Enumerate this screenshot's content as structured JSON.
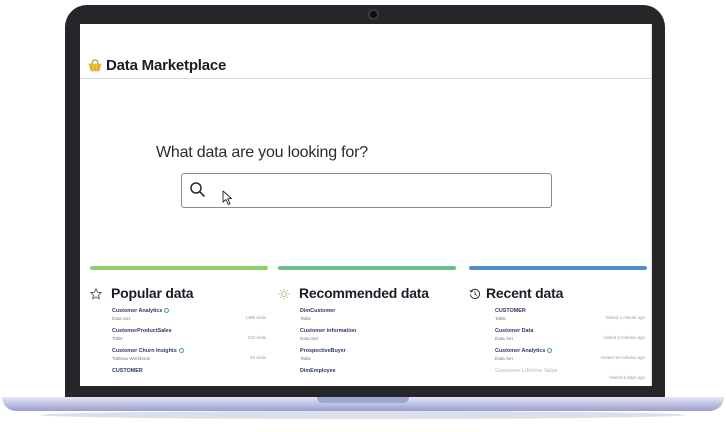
{
  "header": {
    "title": "Data Marketplace"
  },
  "search": {
    "question": "What data are you looking for?",
    "value": ""
  },
  "colors": {
    "popular_bar": "#8fcf6a",
    "recommended_bar": "#6abf8a",
    "recent_bar": "#4a8ecc",
    "check": "#45a85a"
  },
  "panels": {
    "popular": {
      "title": "Popular data",
      "icon": "star-icon",
      "items": [
        {
          "name": "Customer Analytics",
          "type": "Data Set",
          "meta": "1488 visits"
        },
        {
          "name": "CustomerProductSales",
          "type": "Table",
          "meta": "234 visits"
        },
        {
          "name": "Customer Churn Insights",
          "type": "Tableau Workbook",
          "meta": "84 visits"
        },
        {
          "name": "CUSTOMER",
          "type": "",
          "meta": ""
        }
      ]
    },
    "recommended": {
      "title": "Recommended data",
      "icon": "lightbulb-icon",
      "items": [
        {
          "name": "DimCustomer",
          "type": "Table",
          "meta": ""
        },
        {
          "name": "Customer information",
          "type": "Data Set",
          "meta": ""
        },
        {
          "name": "ProspectiveBuyer",
          "type": "Table",
          "meta": ""
        },
        {
          "name": "DimEmployee",
          "type": "",
          "meta": ""
        }
      ]
    },
    "recent": {
      "title": "Recent data",
      "icon": "history-icon",
      "items": [
        {
          "name": "CUSTOMER",
          "type": "Table",
          "meta": "Visited 1 minute ago"
        },
        {
          "name": "Customer Data",
          "type": "Data Set",
          "meta": "Visited 2 minutes ago"
        },
        {
          "name": "Customer Analytics",
          "type": "Data Set",
          "meta": "Visited 16 minutes ago"
        },
        {
          "name": "Customer Lifetime Value",
          "type": "",
          "meta": "Visited 5 days ago"
        }
      ]
    }
  }
}
